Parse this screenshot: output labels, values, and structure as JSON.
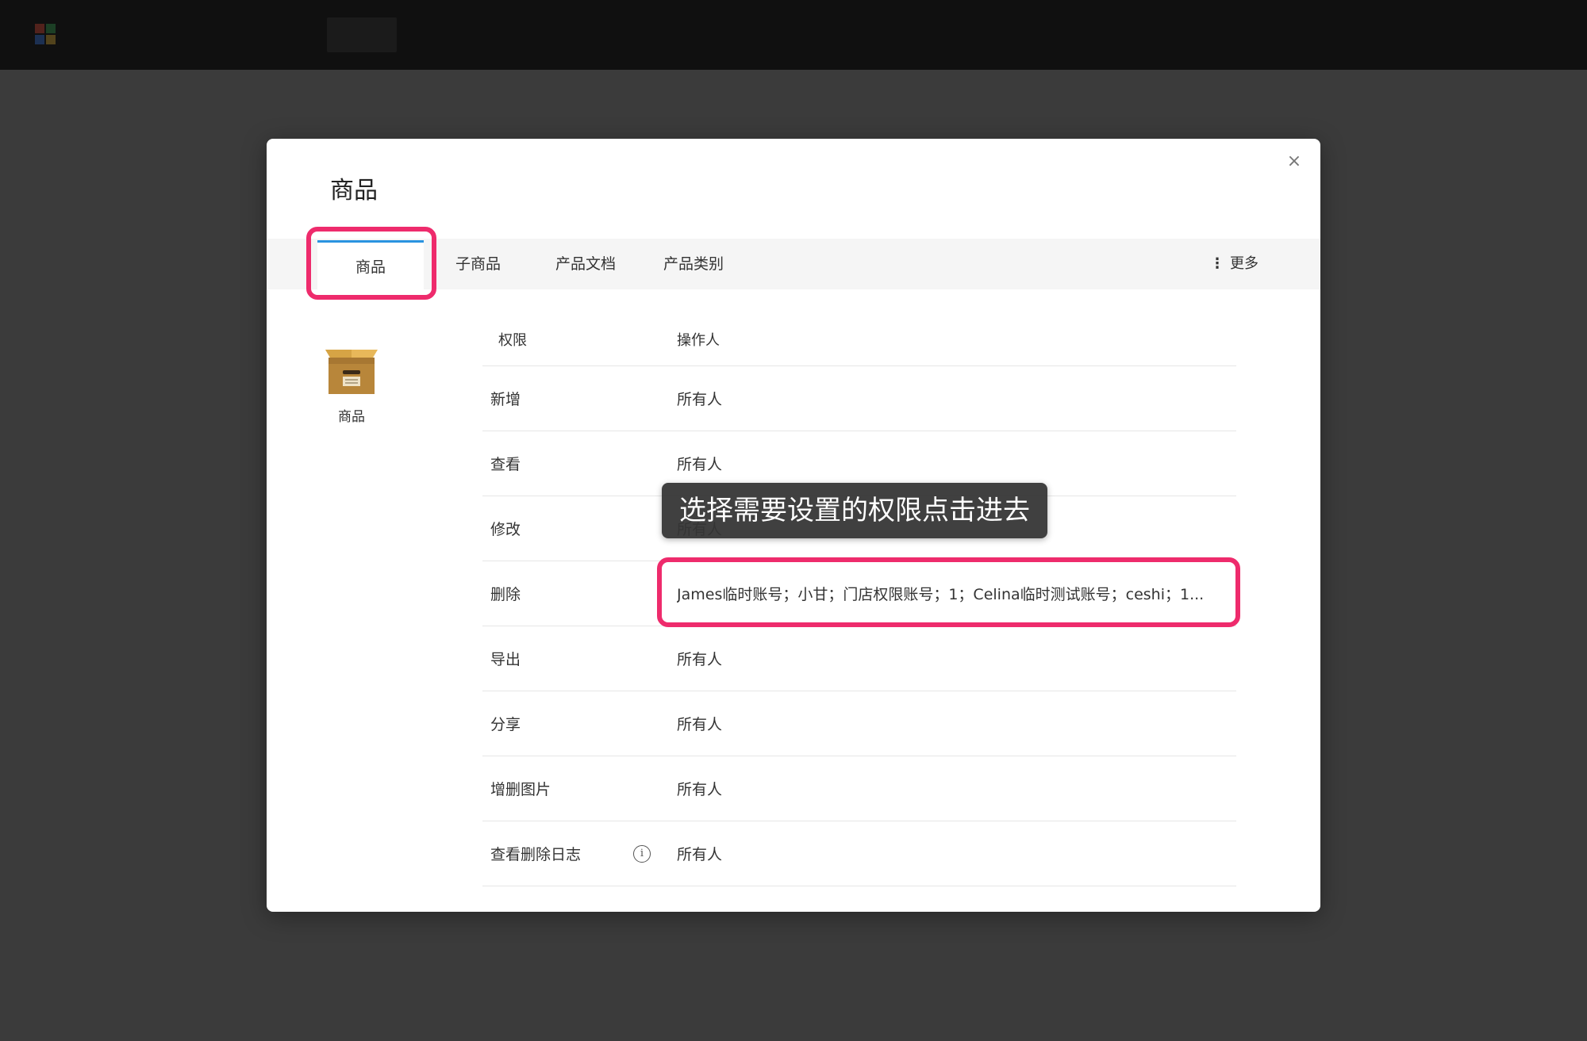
{
  "background_app": {
    "nav_items": [
      "",
      "",
      ""
    ],
    "user_name": "",
    "logout_label": "",
    "window_controls": {
      "minimize": "",
      "maximize": "",
      "close": ""
    }
  },
  "modal": {
    "title": "商品",
    "close_icon": "×",
    "tabs": [
      {
        "label": "商品",
        "active": true
      },
      {
        "label": "子商品",
        "active": false
      },
      {
        "label": "产品文档",
        "active": false
      },
      {
        "label": "产品类别",
        "active": false
      }
    ],
    "more_label": "更多",
    "more_icon": "⋮",
    "side_card": {
      "icon": "box-icon",
      "label": "商品"
    },
    "table": {
      "headers": {
        "permission": "权限",
        "operator": "操作人"
      },
      "rows": [
        {
          "permission": "新增",
          "operator": "所有人"
        },
        {
          "permission": "查看",
          "operator": "所有人"
        },
        {
          "permission": "修改",
          "operator": "所有人"
        },
        {
          "permission": "删除",
          "operator": "James临时账号；小甘；门店权限账号；1；Celina临时测试账号；ceshi；1..."
        },
        {
          "permission": "导出",
          "operator": "所有人"
        },
        {
          "permission": "分享",
          "operator": "所有人"
        },
        {
          "permission": "增删图片",
          "operator": "所有人"
        },
        {
          "permission": "查看删除日志",
          "operator": "所有人",
          "info_icon": "ⓘ"
        }
      ]
    }
  },
  "caption": "选择需要设置的权限点击进去",
  "colors": {
    "highlight": "#ee2b6c",
    "active_tab": "#2a93e0",
    "overlay": "#404040"
  }
}
